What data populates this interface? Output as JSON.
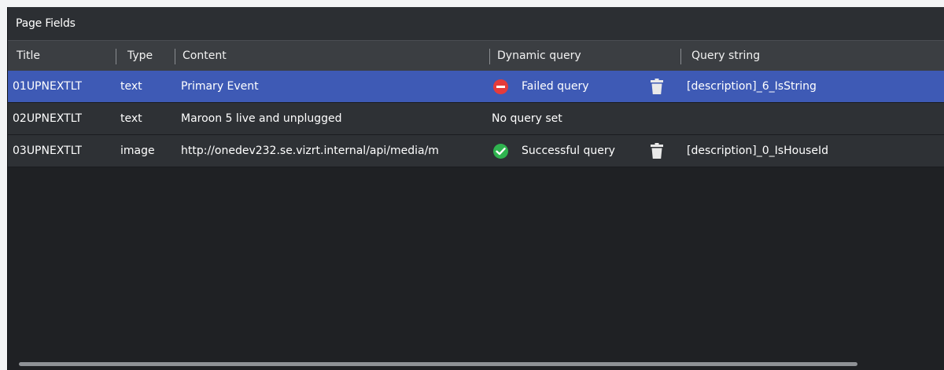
{
  "panel": {
    "title": "Page Fields"
  },
  "columns": {
    "title": "Title",
    "type": "Type",
    "content": "Content",
    "dynamic_query": "Dynamic query",
    "query_string": "Query string"
  },
  "rows": [
    {
      "title": "01UPNEXTLT",
      "type": "text",
      "content": "Primary Event",
      "query_status": "Failed query",
      "status_icon": "failed-icon",
      "query_string": "[description]_6_IsString",
      "selected": true
    },
    {
      "title": "02UPNEXTLT",
      "type": "text",
      "content": "Maroon 5 live and unplugged",
      "query_status": "No query set",
      "status_icon": "",
      "query_string": "",
      "selected": false
    },
    {
      "title": "03UPNEXTLT",
      "type": "image",
      "content": "http://onedev232.se.vizrt.internal/api/media/m",
      "query_status": "Successful query",
      "status_icon": "success-icon",
      "query_string": "[description]_0_IsHouseId",
      "selected": false
    }
  ],
  "colors": {
    "selected_row": "#3e5ab5",
    "failed": "#e53b3b",
    "success": "#2fb34f"
  }
}
